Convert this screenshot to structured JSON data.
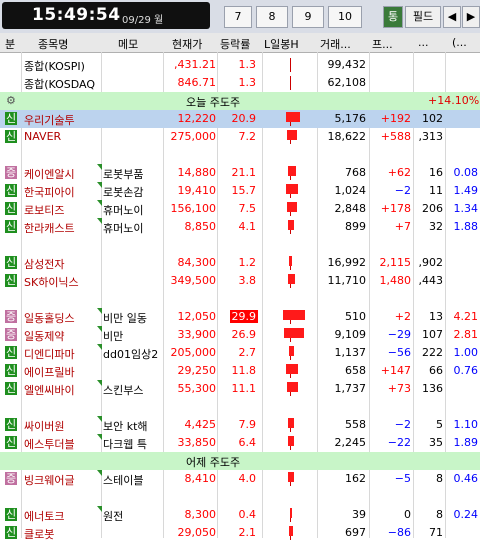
{
  "top": {
    "time": "15:49:54",
    "date": "09/29 월",
    "pages": [
      "7",
      "8",
      "9",
      "10"
    ],
    "buttons": [
      "통",
      "필드",
      "◀",
      "▶"
    ]
  },
  "columns": [
    "분",
    "종목명",
    "메모",
    "현재가",
    "등락률",
    "L일봉H",
    "거래...",
    "프...",
    "...",
    "(..."
  ],
  "sections": {
    "today": "오늘 주도주",
    "today_value": "+14.10%",
    "yesterday": "어제 주도주"
  },
  "rows": [
    {
      "badge": "",
      "name": "종합(KOSPI)",
      "memo": "",
      "price": ",431.21",
      "rate": "1.3",
      "bar": 0,
      "vol": "99,432",
      "p": "",
      "e": "",
      "f": ""
    },
    {
      "badge": "",
      "name": "종합(KOSDAQ",
      "memo": "",
      "price": "846.71",
      "rate": "1.3",
      "bar": 0,
      "vol": "62,108",
      "p": "",
      "e": "",
      "f": ""
    },
    {
      "badge": "신",
      "name": "우리기술투",
      "memo": "",
      "price": "12,220",
      "rate": "20.9",
      "bar": 14,
      "vol": "5,176",
      "p": "+192",
      "e": "102",
      "f": ""
    },
    {
      "badge": "신",
      "name": "NAVER",
      "memo": "",
      "price": "275,000",
      "rate": "7.2",
      "bar": 10,
      "vol": "18,622",
      "p": "+588",
      "e": ",313",
      "f": ""
    },
    {
      "badge": "증",
      "name": "케이엔알시",
      "memo": "로봇부품",
      "price": "14,880",
      "rate": "21.1",
      "bar": 8,
      "vol": "768",
      "p": "+62",
      "e": "16",
      "f": "0.08"
    },
    {
      "badge": "신",
      "name": "한국피아이",
      "memo": "로봇손감",
      "price": "19,410",
      "rate": "15.7",
      "bar": 12,
      "vol": "1,024",
      "p": "−2",
      "e": "11",
      "f": "1.49"
    },
    {
      "badge": "신",
      "name": "로보티즈",
      "memo": "휴머노이",
      "price": "156,100",
      "rate": "7.5",
      "bar": 10,
      "vol": "2,848",
      "p": "+178",
      "e": "206",
      "f": "1.34"
    },
    {
      "badge": "신",
      "name": "한라캐스트",
      "memo": "휴머노이",
      "price": "8,850",
      "rate": "4.1",
      "bar": 6,
      "vol": "899",
      "p": "+7",
      "e": "32",
      "f": "1.88"
    },
    {
      "badge": "신",
      "name": "삼성전자",
      "memo": "",
      "price": "84,300",
      "rate": "1.2",
      "bar": 3,
      "vol": "16,992",
      "p": "2,115",
      "e": ",902",
      "f": ""
    },
    {
      "badge": "신",
      "name": "SK하이닉스",
      "memo": "",
      "price": "349,500",
      "rate": "3.8",
      "bar": 7,
      "vol": "11,710",
      "p": "1,480",
      "e": ",443",
      "f": ""
    },
    {
      "badge": "증",
      "name": "일동홀딩스",
      "memo": "비만 일동",
      "price": "12,050",
      "rate": "29.9",
      "bar": 22,
      "vol": "510",
      "p": "+2",
      "e": "13",
      "f": "4.21"
    },
    {
      "badge": "증",
      "name": "일동제약",
      "memo": "비만",
      "price": "33,900",
      "rate": "26.9",
      "bar": 20,
      "vol": "9,109",
      "p": "−29",
      "e": "107",
      "f": "2.81"
    },
    {
      "badge": "신",
      "name": "디엔디파마",
      "memo": "dd01임상2",
      "price": "205,000",
      "rate": "2.7",
      "bar": 5,
      "vol": "1,137",
      "p": "−56",
      "e": "222",
      "f": "1.00"
    },
    {
      "badge": "신",
      "name": "에이프릴바",
      "memo": "",
      "price": "29,250",
      "rate": "11.8",
      "bar": 12,
      "vol": "658",
      "p": "+147",
      "e": "66",
      "f": "0.76"
    },
    {
      "badge": "신",
      "name": "엘엔씨바이",
      "memo": "스킨부스",
      "price": "55,300",
      "rate": "11.1",
      "bar": 11,
      "vol": "1,737",
      "p": "+73",
      "e": "136",
      "f": ""
    },
    {
      "badge": "신",
      "name": "싸이버원",
      "memo": "보안 kt해",
      "price": "4,425",
      "rate": "7.9",
      "bar": 6,
      "vol": "558",
      "p": "−2",
      "e": "5",
      "f": "1.10"
    },
    {
      "badge": "신",
      "name": "에스투더블",
      "memo": "다크웹 특",
      "price": "33,850",
      "rate": "6.4",
      "bar": 6,
      "vol": "2,245",
      "p": "−22",
      "e": "35",
      "f": "1.89"
    },
    {
      "badge": "증",
      "name": "빙크웨어글",
      "memo": "스테이블",
      "price": "8,410",
      "rate": "4.0",
      "bar": 6,
      "vol": "162",
      "p": "−5",
      "e": "8",
      "f": "0.46"
    },
    {
      "badge": "신",
      "name": "에너토크",
      "memo": "원전",
      "price": "8,300",
      "rate": "0.4",
      "bar": 2,
      "vol": "39",
      "p": "0",
      "e": "8",
      "f": "0.24"
    },
    {
      "badge": "신",
      "name": "클로봇",
      "memo": "",
      "price": "29,050",
      "rate": "2.1",
      "bar": 4,
      "vol": "697",
      "p": "−86",
      "e": "71",
      "f": ""
    }
  ],
  "colors": {
    "up": "#ff0000",
    "down": "#0000ff",
    "section": "#c8f5c8",
    "badge_new": "#1f8f1f",
    "badge_jeung": "#c070a0"
  }
}
